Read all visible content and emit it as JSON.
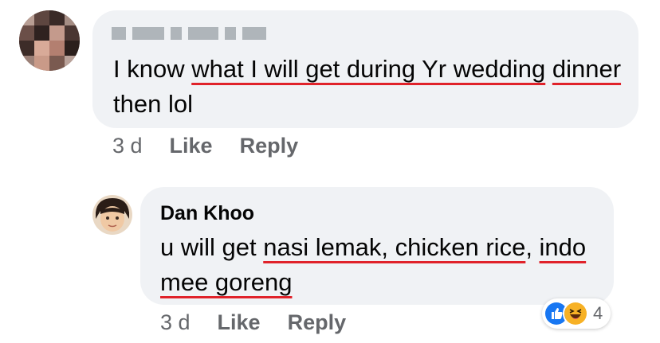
{
  "comments": [
    {
      "author": "",
      "text_segments": [
        {
          "text": "I know ",
          "underline": false
        },
        {
          "text": "what I will get during Yr wedding",
          "underline": true
        },
        {
          "text": " ",
          "underline": false
        },
        {
          "text": "dinner",
          "underline": true
        },
        {
          "text": " then lol",
          "underline": false
        }
      ],
      "time": "3 d",
      "like_label": "Like",
      "reply_label": "Reply"
    },
    {
      "author": "Dan Khoo",
      "text_segments": [
        {
          "text": "u will get ",
          "underline": false
        },
        {
          "text": "nasi lemak, chicken rice",
          "underline": true
        },
        {
          "text": ", ",
          "underline": false
        },
        {
          "text": "indo mee goreng",
          "underline": true
        }
      ],
      "time": "3 d",
      "like_label": "Like",
      "reply_label": "Reply",
      "reactions": {
        "types": [
          "like-icon",
          "haha-icon"
        ],
        "count": "4"
      }
    }
  ],
  "colors": {
    "bubble_bg": "#f0f2f5",
    "secondary_text": "#65676b",
    "spellcheck_underline": "#e0222a",
    "like_blue": "#1877f2",
    "haha_yellow": "#f7b125"
  }
}
